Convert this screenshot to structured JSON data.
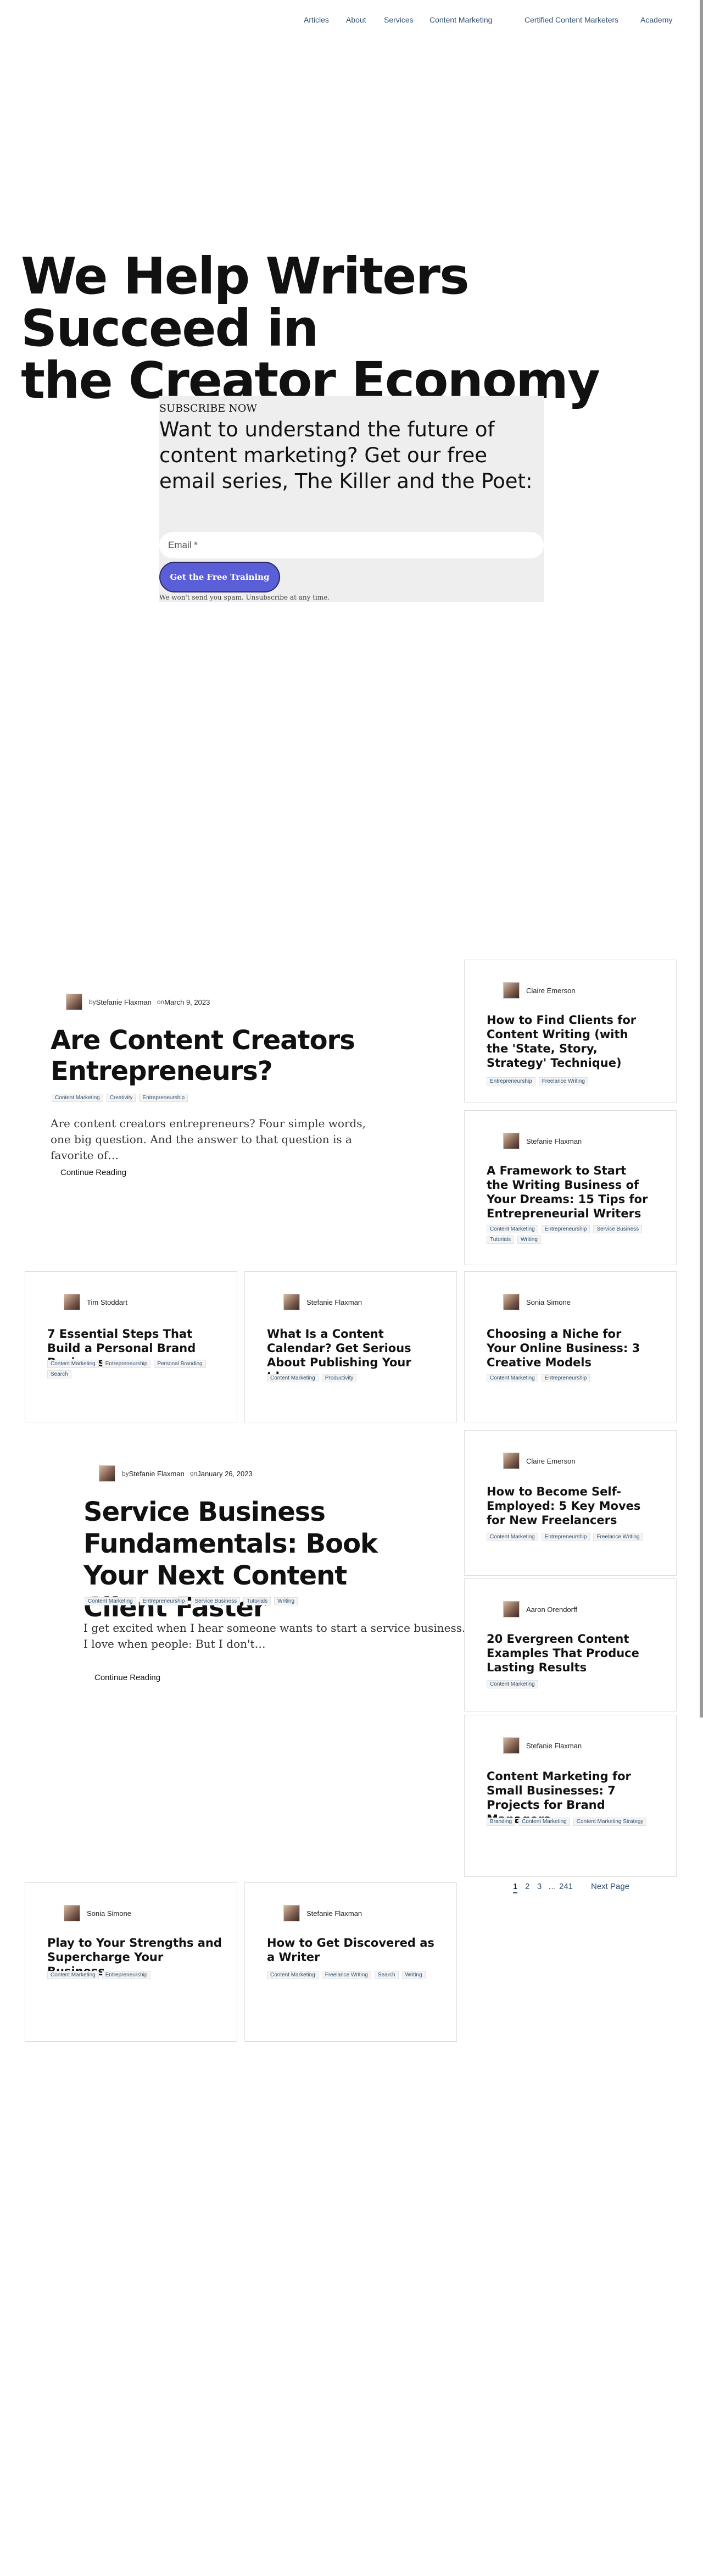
{
  "nav": {
    "items": [
      "Articles",
      "About",
      "Services",
      "Content Marketing",
      "Certified Content Marketers",
      "Academy"
    ]
  },
  "hero": {
    "line1": "We Help Writers Succeed in",
    "line2": "the Creator Economy"
  },
  "subscribe": {
    "label": "SUBSCRIBE NOW",
    "title": "Want to understand the future of content marketing? Get our free email series, The Killer and the Poet:",
    "email_placeholder": "Email *",
    "button": "Get the Free Training",
    "note": "We won't send you spam. Unsubscribe at any time."
  },
  "featured": [
    {
      "author": "Stefanie Flaxman",
      "by": "by",
      "on": "on",
      "date": "March 9, 2023",
      "title": "Are Content Creators Entrepreneurs?",
      "tags": [
        "Content Marketing",
        "Creativity",
        "Entrepreneurship"
      ],
      "excerpt": "Are content creators entrepreneurs? Four simple words, one big question. And the answer to that question is a favorite of…",
      "more": "Continue Reading"
    },
    {
      "author": "Stefanie Flaxman",
      "by": "by",
      "on": "on",
      "date": "January 26, 2023",
      "title": "Service Business Fundamentals: Book Your Next Content Client Faster",
      "tags": [
        "Content Marketing",
        "Entrepreneurship",
        "Service Business",
        "Tutorials",
        "Writing"
      ],
      "excerpt": "I get excited when I hear someone wants to start a service business. I love when people: But I don't…",
      "more": "Continue Reading"
    }
  ],
  "cards": [
    {
      "author": "Claire Emerson",
      "title": "How to Find Clients for Content Writing (with the 'State, Story, Strategy' Technique)",
      "tags": [
        "Entrepreneurship",
        "Freelance Writing"
      ]
    },
    {
      "author": "Stefanie Flaxman",
      "title": "A Framework to Start the Writing Business of Your Dreams: 15 Tips for Entrepreneurial Writers",
      "tags": [
        "Content Marketing",
        "Entrepreneurship",
        "Service Business",
        "Tutorials",
        "Writing"
      ]
    },
    {
      "author": "Tim Stoddart",
      "title": "7 Essential Steps That Build a Personal Brand Business",
      "tags": [
        "Content Marketing",
        "Entrepreneurship",
        "Personal Branding",
        "Search"
      ]
    },
    {
      "author": "Stefanie Flaxman",
      "title": "What Is a Content Calendar? Get Serious About Publishing Your Ideas",
      "tags": [
        "Content Marketing",
        "Productivity"
      ]
    },
    {
      "author": "Sonia Simone",
      "title": "Choosing a Niche for Your Online Business: 3 Creative Models",
      "tags": [
        "Content Marketing",
        "Entrepreneurship"
      ]
    },
    {
      "author": "Claire Emerson",
      "title": "How to Become Self-Employed: 5 Key Moves for New Freelancers",
      "tags": [
        "Content Marketing",
        "Entrepreneurship",
        "Freelance Writing"
      ]
    },
    {
      "author": "Aaron Orendorff",
      "title": "20 Evergreen Content Examples That Produce Lasting Results",
      "tags": [
        "Content Marketing"
      ]
    },
    {
      "author": "Stefanie Flaxman",
      "title": "Content Marketing for Small Businesses: 7 Projects for Brand Managers",
      "tags": [
        "Branding",
        "Content Marketing",
        "Content Marketing Strategy"
      ]
    },
    {
      "author": "Sonia Simone",
      "title": "Play to Your Strengths and Supercharge Your Business",
      "tags": [
        "Content Marketing",
        "Entrepreneurship"
      ]
    },
    {
      "author": "Stefanie Flaxman",
      "title": "How to Get Discovered as a Writer",
      "tags": [
        "Content Marketing",
        "Freelance Writing",
        "Search",
        "Writing"
      ]
    }
  ],
  "pagination": {
    "pages": [
      "1",
      "2",
      "3",
      "…",
      "241"
    ],
    "next": "Next Page"
  },
  "colors": {
    "accent": "#5b5fd7",
    "link": "#2f4f6f",
    "panel": "#eeeeee"
  }
}
